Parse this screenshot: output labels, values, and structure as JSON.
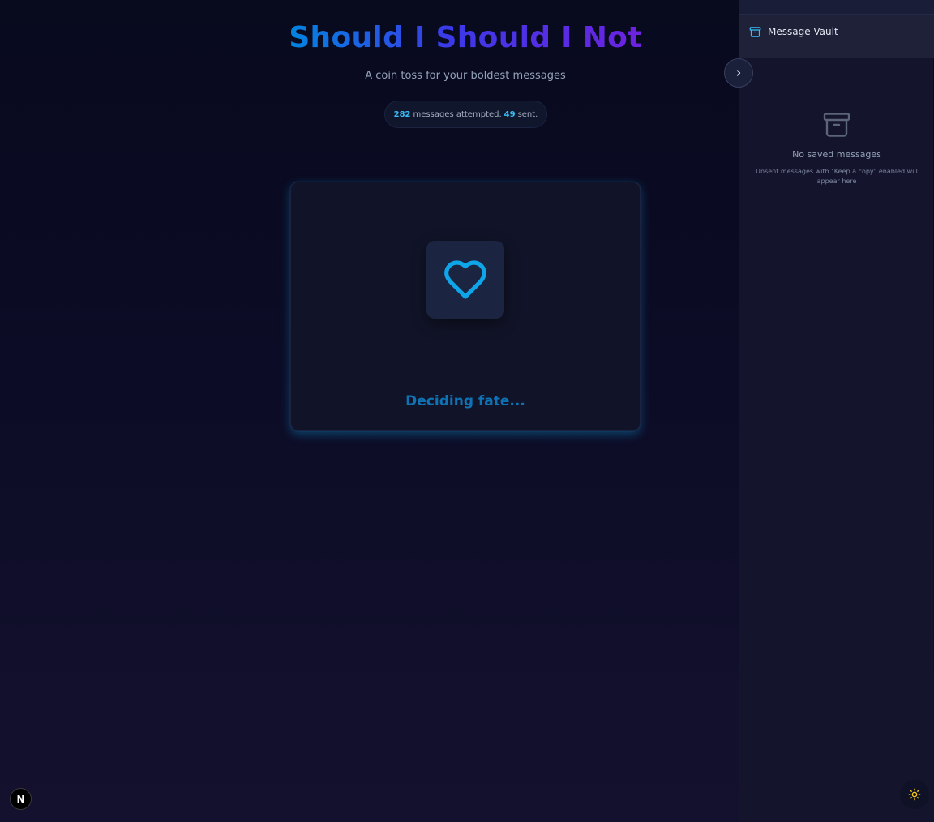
{
  "app": {
    "title": "Should I Should I Not",
    "subtitle": "A coin toss for your boldest messages"
  },
  "stats": {
    "attempted_count": "282",
    "attempted_label": "messages attempted.",
    "sent_count": "49",
    "sent_label": "sent."
  },
  "card": {
    "status_text": "Deciding fate...",
    "icon": "heart-icon"
  },
  "sidebar": {
    "title": "Message Vault",
    "header_icon": "archive-icon",
    "empty_title": "No saved messages",
    "empty_description": "Unsent messages with \"Keep a copy\" enabled will appear here",
    "empty_icon": "archive-icon",
    "toggle_icon": "chevron-right-icon"
  },
  "footer": {
    "badge_letter": "N",
    "theme_icon": "sun-icon"
  },
  "colors": {
    "accent": "#38bdf8",
    "title_gradient_start": "#0284e0",
    "title_gradient_end": "#6d22e0",
    "status_text": "#0e72b4",
    "theme_icon": "#facc15"
  }
}
